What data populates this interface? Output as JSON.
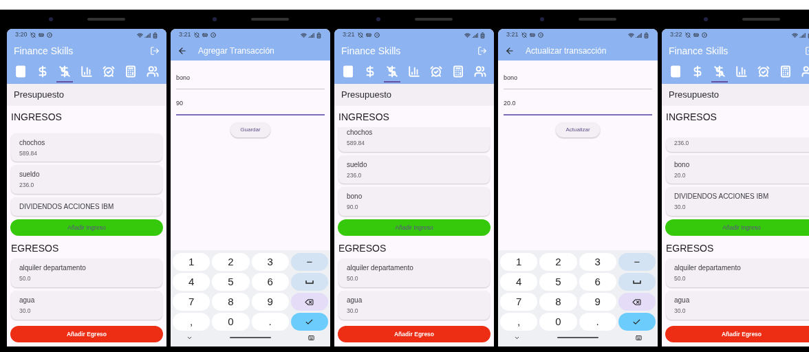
{
  "phones": [
    {
      "kind": "budget",
      "time": "3:20",
      "title": "Finance Skills",
      "tabs": [
        {
          "selected": false
        },
        {
          "selected": false
        },
        {
          "selected": true
        },
        {
          "selected": false
        },
        {
          "selected": false
        },
        {
          "selected": false
        },
        {
          "selected": false
        }
      ],
      "section": "Presupuesto",
      "income_heading": "INGRESOS",
      "income": [
        {
          "name": "chochos",
          "amount": "589.84"
        },
        {
          "name": "sueldo",
          "amount": "236.0"
        },
        {
          "name": "DIVIDENDOS ACCIONES IBM"
        }
      ],
      "income_button": "Añadir Ingreso",
      "expense_heading": "EGRESOS",
      "expenses": [
        {
          "name": "alquiler departamento",
          "amount": "50.0"
        },
        {
          "name": "agua",
          "amount": "30.0"
        }
      ],
      "expense_button": "Añadir Egreso"
    },
    {
      "kind": "form",
      "time": "3:21",
      "title": "Agregar Transacción",
      "fields": [
        {
          "value": "bono",
          "focused": false
        },
        {
          "value": "90",
          "focused": true
        }
      ],
      "button": "Guardar",
      "keyboard": {
        "keys": [
          {
            "kind": "char",
            "label": "1"
          },
          {
            "kind": "char",
            "label": "2"
          },
          {
            "kind": "char",
            "label": "3"
          },
          {
            "kind": "dash",
            "label": "−"
          },
          {
            "kind": "char",
            "label": "4"
          },
          {
            "kind": "char",
            "label": "5"
          },
          {
            "kind": "char",
            "label": "6"
          },
          {
            "kind": "space"
          },
          {
            "kind": "char",
            "label": "7"
          },
          {
            "kind": "char",
            "label": "8"
          },
          {
            "kind": "char",
            "label": "9"
          },
          {
            "kind": "backspace"
          },
          {
            "kind": "char",
            "label": ","
          },
          {
            "kind": "char",
            "label": "0"
          },
          {
            "kind": "char",
            "label": "."
          },
          {
            "kind": "enter"
          }
        ]
      }
    },
    {
      "kind": "budget",
      "time": "3:21",
      "title": "Finance Skills",
      "tabs": [
        {
          "selected": false
        },
        {
          "selected": false
        },
        {
          "selected": true
        },
        {
          "selected": false
        },
        {
          "selected": false
        },
        {
          "selected": false
        },
        {
          "selected": false
        }
      ],
      "section": "Presupuesto",
      "income_heading": "INGRESOS",
      "income": [
        {
          "name": "chochos",
          "amount": "589.84"
        },
        {
          "name": "sueldo",
          "amount": "236.0"
        },
        {
          "name": "bono",
          "amount": "90.0"
        }
      ],
      "income_button": "Añadir Ingreso",
      "expense_heading": "EGRESOS",
      "expenses": [
        {
          "name": "alquiler departamento",
          "amount": "50.0"
        },
        {
          "name": "agua",
          "amount": "30.0"
        }
      ],
      "expense_button": "Añadir Egreso"
    },
    {
      "kind": "form",
      "time": "3:21",
      "title": "Actualizar transacción",
      "fields": [
        {
          "value": "bono",
          "focused": false
        },
        {
          "value": "20.0",
          "focused": true
        }
      ],
      "button": "Actualizar",
      "keyboard": {
        "keys": [
          {
            "kind": "char",
            "label": "1"
          },
          {
            "kind": "char",
            "label": "2"
          },
          {
            "kind": "char",
            "label": "3"
          },
          {
            "kind": "dash",
            "label": "−"
          },
          {
            "kind": "char",
            "label": "4"
          },
          {
            "kind": "char",
            "label": "5"
          },
          {
            "kind": "char",
            "label": "6"
          },
          {
            "kind": "space"
          },
          {
            "kind": "char",
            "label": "7"
          },
          {
            "kind": "char",
            "label": "8"
          },
          {
            "kind": "char",
            "label": "9"
          },
          {
            "kind": "backspace"
          },
          {
            "kind": "char",
            "label": ","
          },
          {
            "kind": "char",
            "label": "0"
          },
          {
            "kind": "char",
            "label": "."
          },
          {
            "kind": "enter"
          }
        ]
      }
    },
    {
      "kind": "budget",
      "time": "3:22",
      "title": "Finance Skills",
      "tabs": [
        {
          "selected": false
        },
        {
          "selected": false
        },
        {
          "selected": true
        },
        {
          "selected": false
        },
        {
          "selected": false
        },
        {
          "selected": false
        },
        {
          "selected": false
        }
      ],
      "section": "Presupuesto",
      "income_heading": "INGRESOS",
      "income": [
        {
          "amount": "236.0"
        },
        {
          "name": "bono",
          "amount": "20.0"
        },
        {
          "name": "DIVIDENDOS ACCIONES IBM",
          "amount": "30.0"
        }
      ],
      "income_button": "Añadir Ingreso",
      "expense_heading": "EGRESOS",
      "expenses": [
        {
          "name": "alquiler departamento",
          "amount": "50.0"
        },
        {
          "name": "agua",
          "amount": "30.0"
        }
      ],
      "expense_button": "Añadir Egreso"
    }
  ]
}
